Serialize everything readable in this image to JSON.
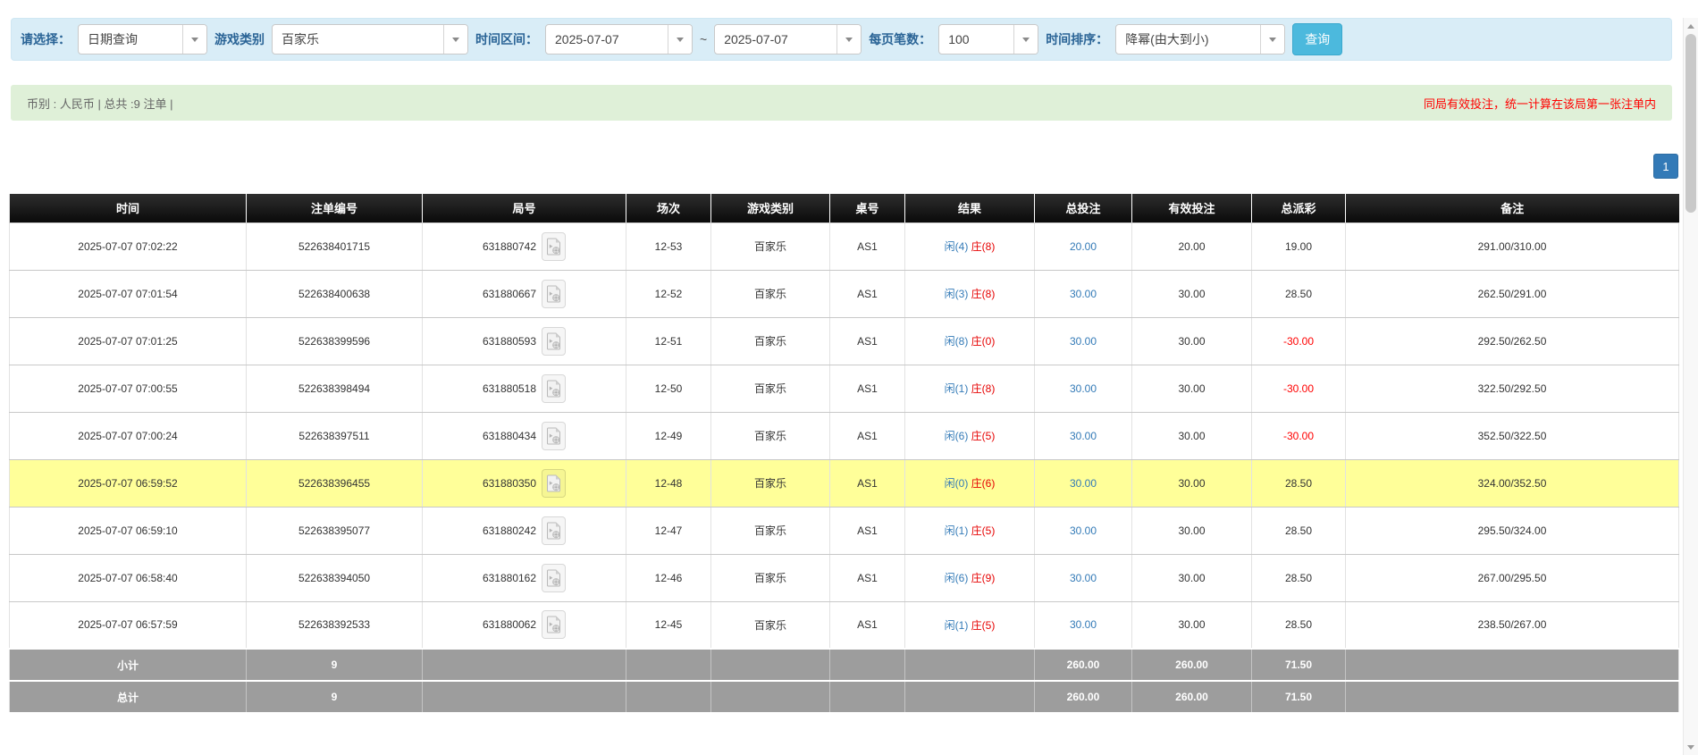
{
  "filter": {
    "label_query_type": "请选择：",
    "query_type_value": "日期查询",
    "label_game_category": "游戏类别",
    "game_category_value": "百家乐",
    "label_time_range": "时间区间：",
    "date_from_value": "2025-07-07",
    "range_separator": "~",
    "date_to_value": "2025-07-07",
    "label_page_size": "每页笔数：",
    "page_size_value": "100",
    "label_sort": "时间排序：",
    "sort_value": "降幂(由大到小)",
    "search_button_label": "查询"
  },
  "summary": {
    "left_text": "币别 : 人民币 | 总共 :9 注单 |",
    "right_notice": "同局有效投注，统一计算在该局第一张注单内"
  },
  "pagination": {
    "current_page": "1"
  },
  "table": {
    "headers": [
      "时间",
      "注单编号",
      "局号",
      "场次",
      "游戏类别",
      "桌号",
      "结果",
      "总投注",
      "有效投注",
      "总派彩",
      "备注"
    ],
    "rows": [
      {
        "time": "2025-07-07 07:02:22",
        "bet_id": "522638401715",
        "round_id": "631880742",
        "session": "12-53",
        "game": "百家乐",
        "table_no": "AS1",
        "result_player": "闲(4)",
        "result_banker": "庄(8)",
        "total_bet": "20.00",
        "valid_bet": "20.00",
        "payout": "19.00",
        "note": "291.00/310.00",
        "highlighted": false
      },
      {
        "time": "2025-07-07 07:01:54",
        "bet_id": "522638400638",
        "round_id": "631880667",
        "session": "12-52",
        "game": "百家乐",
        "table_no": "AS1",
        "result_player": "闲(3)",
        "result_banker": "庄(8)",
        "total_bet": "30.00",
        "valid_bet": "30.00",
        "payout": "28.50",
        "note": "262.50/291.00",
        "highlighted": false
      },
      {
        "time": "2025-07-07 07:01:25",
        "bet_id": "522638399596",
        "round_id": "631880593",
        "session": "12-51",
        "game": "百家乐",
        "table_no": "AS1",
        "result_player": "闲(8)",
        "result_banker": "庄(0)",
        "total_bet": "30.00",
        "valid_bet": "30.00",
        "payout": "-30.00",
        "note": "292.50/262.50",
        "highlighted": false
      },
      {
        "time": "2025-07-07 07:00:55",
        "bet_id": "522638398494",
        "round_id": "631880518",
        "session": "12-50",
        "game": "百家乐",
        "table_no": "AS1",
        "result_player": "闲(1)",
        "result_banker": "庄(8)",
        "total_bet": "30.00",
        "valid_bet": "30.00",
        "payout": "-30.00",
        "note": "322.50/292.50",
        "highlighted": false
      },
      {
        "time": "2025-07-07 07:00:24",
        "bet_id": "522638397511",
        "round_id": "631880434",
        "session": "12-49",
        "game": "百家乐",
        "table_no": "AS1",
        "result_player": "闲(6)",
        "result_banker": "庄(5)",
        "total_bet": "30.00",
        "valid_bet": "30.00",
        "payout": "-30.00",
        "note": "352.50/322.50",
        "highlighted": false
      },
      {
        "time": "2025-07-07 06:59:52",
        "bet_id": "522638396455",
        "round_id": "631880350",
        "session": "12-48",
        "game": "百家乐",
        "table_no": "AS1",
        "result_player": "闲(0)",
        "result_banker": "庄(6)",
        "total_bet": "30.00",
        "valid_bet": "30.00",
        "payout": "28.50",
        "note": "324.00/352.50",
        "highlighted": true
      },
      {
        "time": "2025-07-07 06:59:10",
        "bet_id": "522638395077",
        "round_id": "631880242",
        "session": "12-47",
        "game": "百家乐",
        "table_no": "AS1",
        "result_player": "闲(1)",
        "result_banker": "庄(5)",
        "total_bet": "30.00",
        "valid_bet": "30.00",
        "payout": "28.50",
        "note": "295.50/324.00",
        "highlighted": false
      },
      {
        "time": "2025-07-07 06:58:40",
        "bet_id": "522638394050",
        "round_id": "631880162",
        "session": "12-46",
        "game": "百家乐",
        "table_no": "AS1",
        "result_player": "闲(6)",
        "result_banker": "庄(9)",
        "total_bet": "30.00",
        "valid_bet": "30.00",
        "payout": "28.50",
        "note": "267.00/295.50",
        "highlighted": false
      },
      {
        "time": "2025-07-07 06:57:59",
        "bet_id": "522638392533",
        "round_id": "631880062",
        "session": "12-45",
        "game": "百家乐",
        "table_no": "AS1",
        "result_player": "闲(1)",
        "result_banker": "庄(5)",
        "total_bet": "30.00",
        "valid_bet": "30.00",
        "payout": "28.50",
        "note": "238.50/267.00",
        "highlighted": false
      }
    ],
    "subtotal": {
      "label": "小计",
      "count": "9",
      "total_bet": "260.00",
      "valid_bet": "260.00",
      "payout": "71.50"
    },
    "grand_total": {
      "label": "总计",
      "count": "9",
      "total_bet": "260.00",
      "valid_bet": "260.00",
      "payout": "71.50"
    }
  },
  "colors": {
    "filter_bg": "#d9edf7",
    "label_blue": "#2a6496",
    "search_button_bg": "#4cb9dd",
    "summary_bg": "#dff0d8",
    "notice_red": "#ff0000",
    "header_bg": "#111111",
    "highlight_row_yellow": "#ffff99",
    "footer_gray": "#9d9d9d",
    "link_blue": "#337ab7",
    "player_blue": "#337ab7",
    "banker_red": "#e60000",
    "negative_red": "#ff0000"
  }
}
